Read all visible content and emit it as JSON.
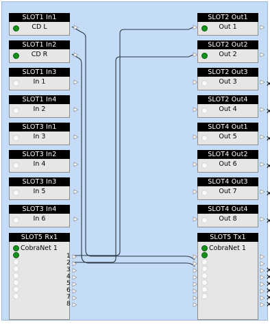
{
  "inputs": [
    {
      "header": "SLOT1  In1",
      "label": "CD L",
      "active": true
    },
    {
      "header": "SLOT1  In2",
      "label": "CD R",
      "active": true
    },
    {
      "header": "SLOT1  In3",
      "label": "In 1",
      "active": false
    },
    {
      "header": "SLOT1  In4",
      "label": "In 2",
      "active": false
    },
    {
      "header": "SLOT3  In1",
      "label": "In 3",
      "active": false
    },
    {
      "header": "SLOT3  In2",
      "label": "In 4",
      "active": false
    },
    {
      "header": "SLOT3  In3",
      "label": "In 5",
      "active": false
    },
    {
      "header": "SLOT3  In4",
      "label": "In 6",
      "active": false
    }
  ],
  "outputs": [
    {
      "header": "SLOT2  Out1",
      "label": "Out 1",
      "active": true,
      "disconnected": false
    },
    {
      "header": "SLOT2  Out2",
      "label": "Out 2",
      "active": true,
      "disconnected": false
    },
    {
      "header": "SLOT2  Out3",
      "label": "Out 3",
      "active": false,
      "disconnected": true
    },
    {
      "header": "SLOT2  Out4",
      "label": "Out 4",
      "active": false,
      "disconnected": true
    },
    {
      "header": "SLOT4  Out1",
      "label": "Out 5",
      "active": false,
      "disconnected": true
    },
    {
      "header": "SLOT4  Out2",
      "label": "Out 6",
      "active": false,
      "disconnected": true
    },
    {
      "header": "SLOT4  Out3",
      "label": "Out 7",
      "active": false,
      "disconnected": true
    },
    {
      "header": "SLOT4  Out4",
      "label": "Out 8",
      "active": false,
      "disconnected": true
    }
  ],
  "rx": {
    "header": "SLOT5  Rx1",
    "label": "CobraNet 1",
    "ports": [
      "1",
      "2",
      "3",
      "4",
      "5",
      "6",
      "7",
      "8"
    ],
    "leds_active": [
      true,
      true,
      false,
      false,
      false,
      false,
      false,
      false
    ]
  },
  "tx": {
    "header": "SLOT5  Tx1",
    "label": "CobraNet 1",
    "leds_active": [
      true,
      true,
      false,
      false,
      false,
      false,
      false,
      false
    ],
    "disconnected": [
      false,
      false,
      true,
      true,
      true,
      true,
      true,
      true
    ]
  },
  "icons": {
    "led_on_color": "#139019",
    "disconnect_mark": "✕",
    "port_arrow": "▷"
  },
  "colors": {
    "canvas": "#c4dcf7",
    "header": "#000000",
    "body": "#e6e6e6",
    "wire": "#2a3440"
  }
}
